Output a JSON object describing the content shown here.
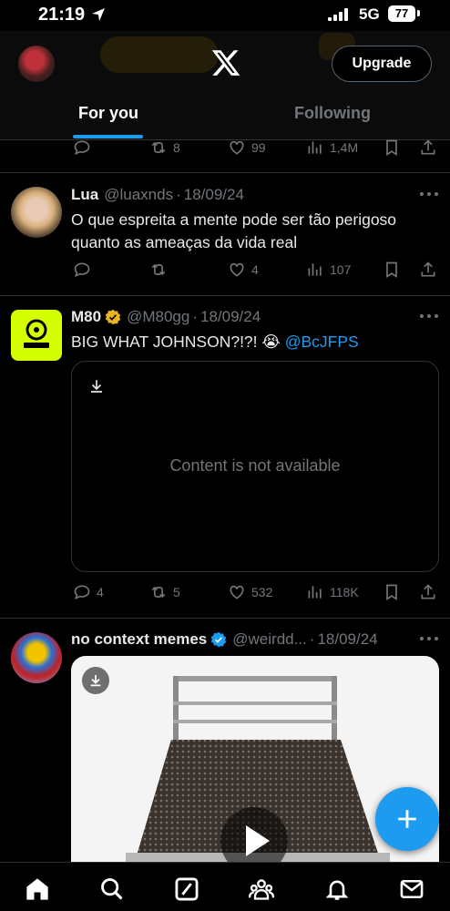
{
  "status_bar": {
    "time": "21:19",
    "network": "5G",
    "battery": "77"
  },
  "header": {
    "upgrade_label": "Upgrade",
    "tabs": [
      {
        "label": "For you",
        "selected": true
      },
      {
        "label": "Following",
        "selected": false
      }
    ]
  },
  "partial_tweet": {
    "retweets": "8",
    "likes": "99",
    "views": "1,4M"
  },
  "tweets": [
    {
      "name": "Lua",
      "handle": "@luaxnds",
      "date": "18/09/24",
      "text_line1": "O que espreita a mente pode ser tão perigoso",
      "text_line2": "quanto as ameaças da vida real",
      "replies": "",
      "retweets": "",
      "likes": "4",
      "views": "107"
    },
    {
      "name": "M80",
      "handle": "@M80gg",
      "date": "18/09/24",
      "text": "BIG WHAT JOHNSON?!?! 😭",
      "mention": "@BcJFPS",
      "media_message": "Content is not available",
      "replies": "4",
      "retweets": "5",
      "likes": "532",
      "views": "118K"
    },
    {
      "name": "no context memes",
      "handle": "@weirdd...",
      "date": "18/09/24"
    }
  ],
  "colors": {
    "accent": "#1d9bf0",
    "background": "#000000",
    "muted": "#71767b",
    "verified_gold": "#e8b324"
  },
  "bottom_nav": [
    "home-icon",
    "search-icon",
    "grok-icon",
    "communities-icon",
    "notifications-icon",
    "messages-icon"
  ]
}
